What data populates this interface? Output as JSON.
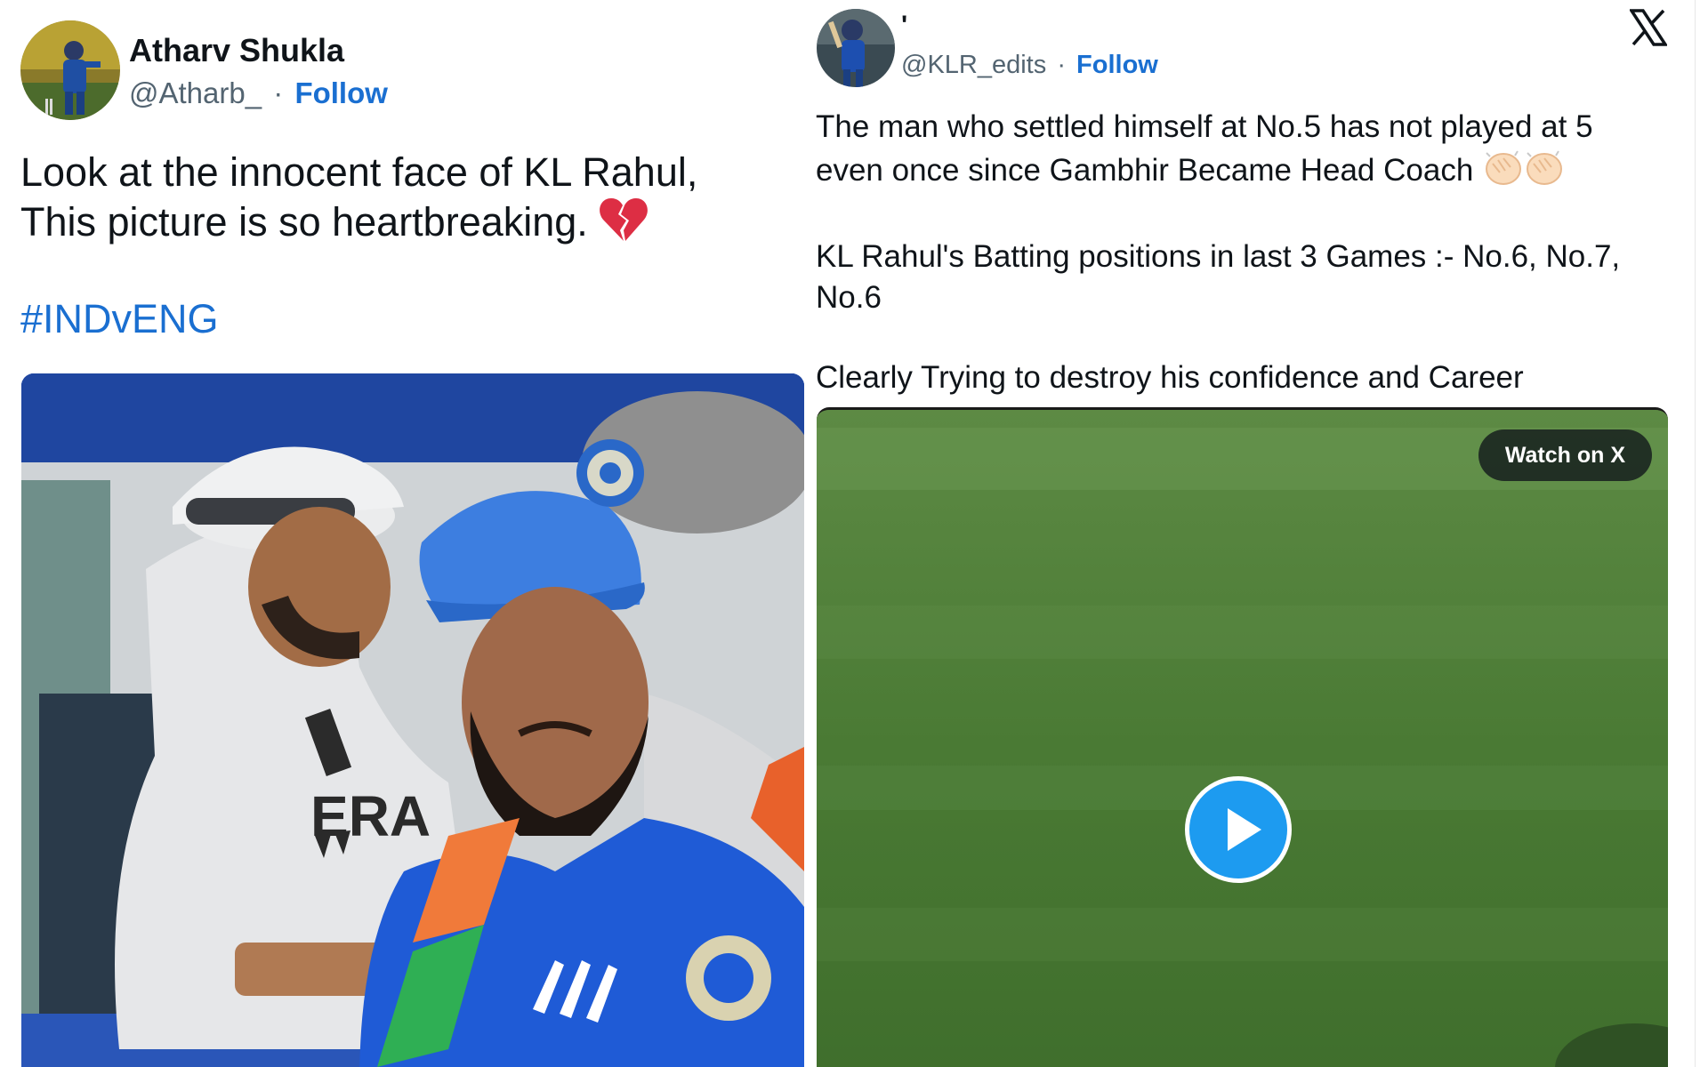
{
  "left_tweet": {
    "author_name": "Atharv Shukla",
    "handle": "@Atharb_",
    "separator": "·",
    "follow_label": "Follow",
    "text_line1": "Look at the innocent face of KL Rahul,",
    "text_line2": "This picture is so heartbreaking.",
    "emoji": "broken-heart-icon",
    "hashtag": "#INDvENG"
  },
  "right_tweet": {
    "author_name": "'",
    "handle": "@KLR_edits",
    "separator": "·",
    "follow_label": "Follow",
    "paragraph1": "The man who settled himself at No.5 has not played at 5 even once since Gambhir Became Head Coach",
    "emoji": "clapping-hands-icon",
    "paragraph2": "KL Rahul's Batting positions in last 3 Games :- No.6, No.7, No.6",
    "paragraph3": "Clearly Trying to destroy his confidence and Career",
    "watch_label": "Watch on X"
  },
  "brand": {
    "logo": "x-logo-icon",
    "accent_color": "#1a6fd1",
    "play_color": "#1d9bf0"
  }
}
